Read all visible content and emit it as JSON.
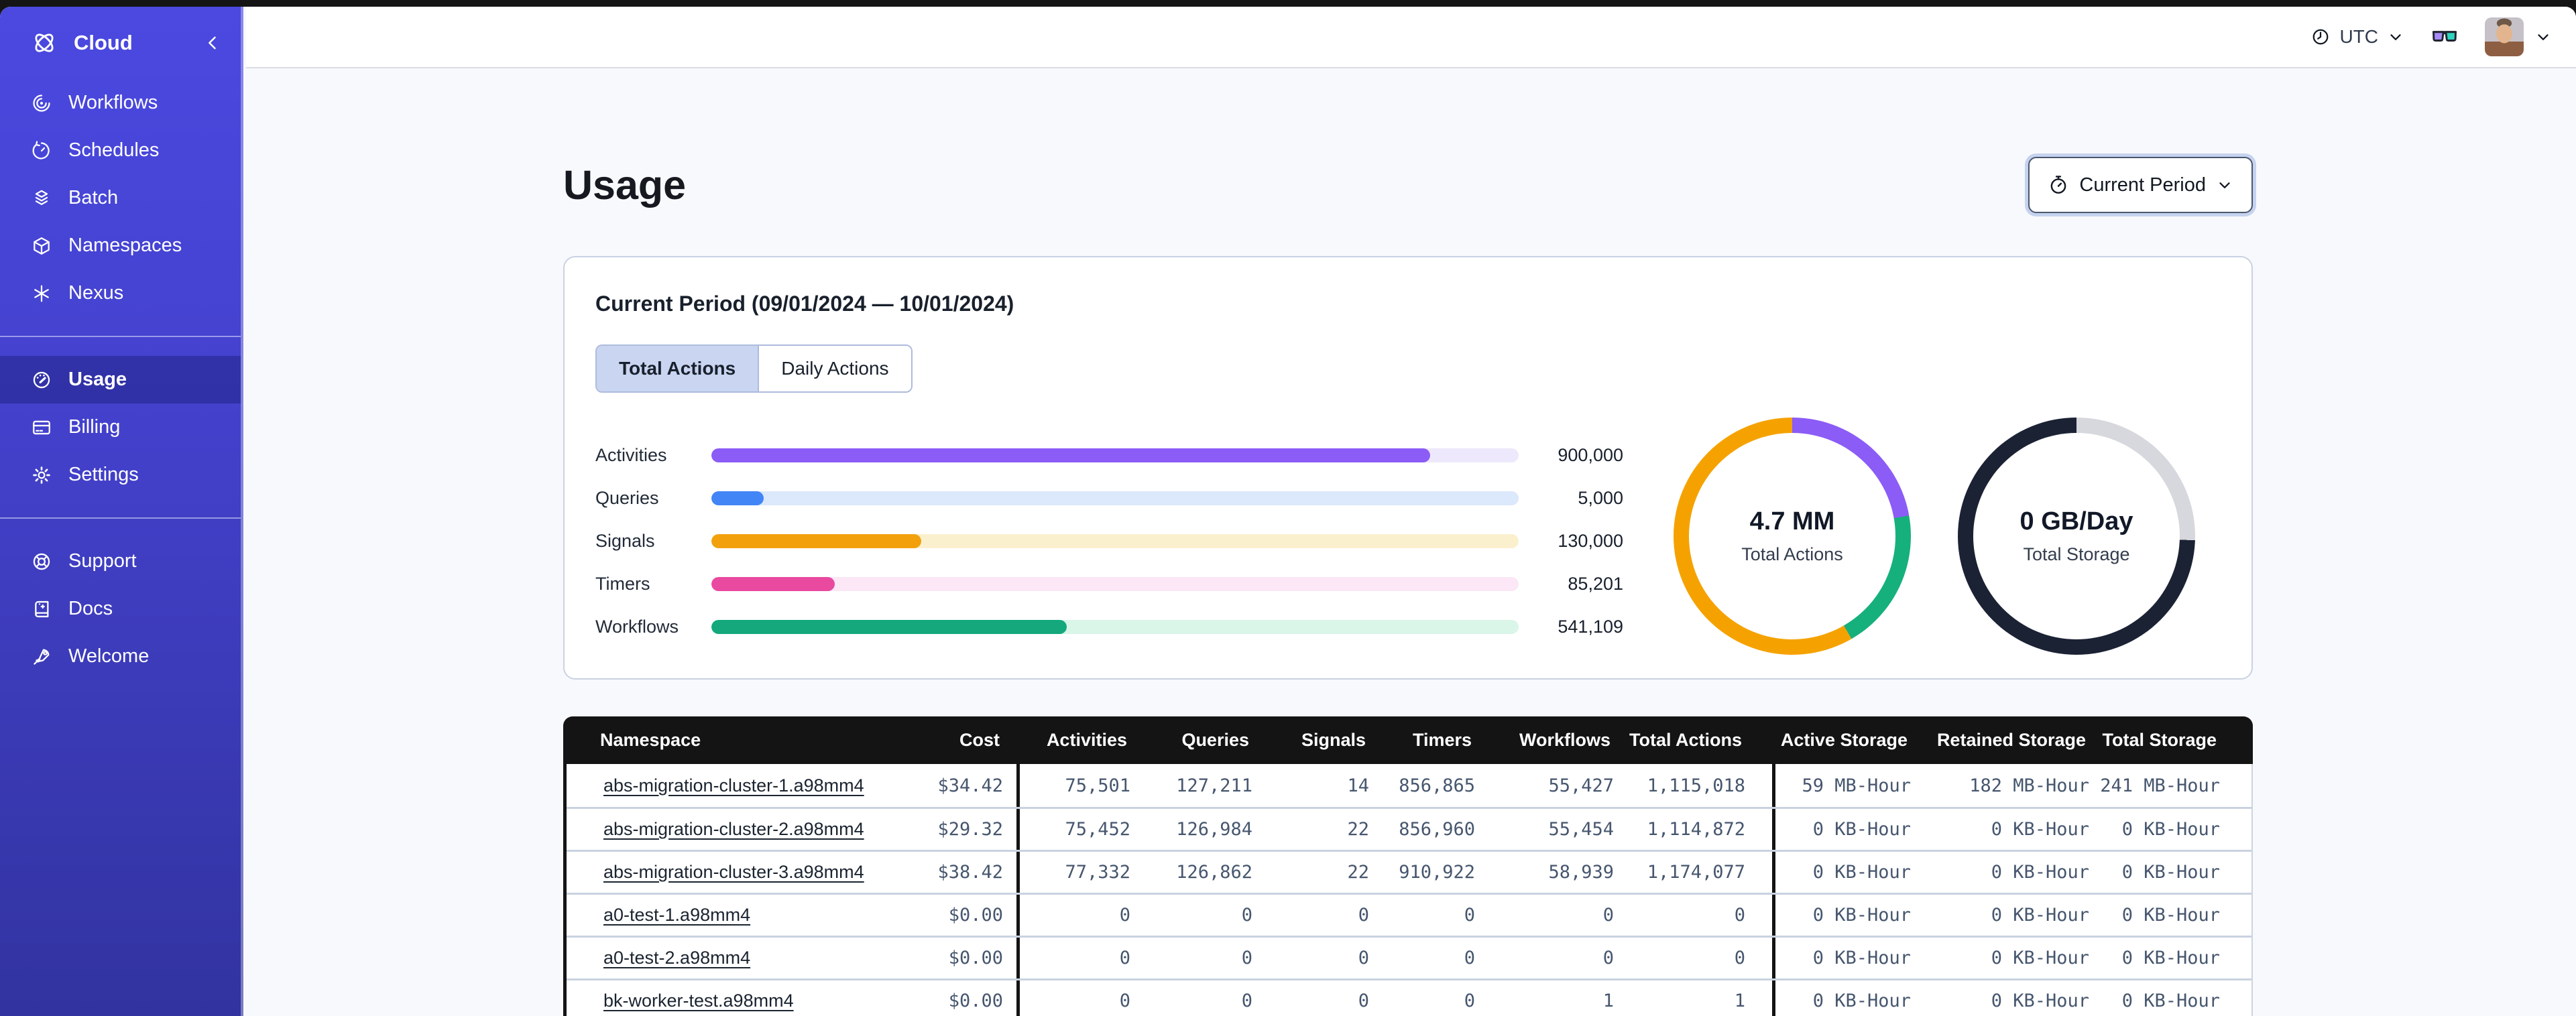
{
  "theme": {
    "sidebar_top": "#4B49E0",
    "sidebar_bottom": "#3233A0",
    "sidebar_selected": "rgba(13,16,96,0.35)",
    "topbar_bg": "#FFFFFF",
    "page_bg": "#F8F9FC",
    "header_bg": "#141414",
    "tab_selected_bg": "#C9D5F1",
    "focus_ring": "#C5D3EF",
    "card_border": "#C9D2E2",
    "cell": "#46566E",
    "glasses_left_lens": "#A78BFA",
    "glasses_right_lens": "#2DD4BF"
  },
  "sidebar": {
    "logo_label": "Cloud",
    "nav_main": [
      {
        "key": "workflows",
        "label": "Workflows",
        "icon": "workflows-icon"
      },
      {
        "key": "schedules",
        "label": "Schedules",
        "icon": "schedules-icon"
      },
      {
        "key": "batch",
        "label": "Batch",
        "icon": "batch-icon"
      },
      {
        "key": "namespaces",
        "label": "Namespaces",
        "icon": "namespaces-icon"
      },
      {
        "key": "nexus",
        "label": "Nexus",
        "icon": "nexus-icon"
      }
    ],
    "nav_account": [
      {
        "key": "usage",
        "label": "Usage",
        "icon": "usage-icon",
        "selected": true
      },
      {
        "key": "billing",
        "label": "Billing",
        "icon": "billing-icon"
      },
      {
        "key": "settings",
        "label": "Settings",
        "icon": "settings-icon"
      }
    ],
    "nav_footer": [
      {
        "key": "support",
        "label": "Support",
        "icon": "support-icon"
      },
      {
        "key": "docs",
        "label": "Docs",
        "icon": "docs-icon"
      },
      {
        "key": "welcome",
        "label": "Welcome",
        "icon": "welcome-icon"
      }
    ]
  },
  "topbar": {
    "timezone": "UTC"
  },
  "page": {
    "title": "Usage",
    "period_button_label": "Current Period"
  },
  "usage_card": {
    "title": "Current Period (09/01/2024 — 10/01/2024)",
    "tabs": [
      {
        "label": "Total Actions",
        "selected": true
      },
      {
        "label": "Daily Actions",
        "selected": false
      }
    ]
  },
  "chart_data": [
    {
      "type": "bar",
      "orientation": "horizontal",
      "title": "Total Actions by type",
      "categories": [
        "Activities",
        "Queries",
        "Signals",
        "Timers",
        "Workflows"
      ],
      "values": [
        900000,
        5000,
        130000,
        85201,
        541109
      ],
      "rows": [
        {
          "label": "Activities",
          "value": 900000,
          "value_display": "900,000",
          "fill_pct": 89,
          "color": "#8B5CF6",
          "track_color": "#EDE8FB"
        },
        {
          "label": "Queries",
          "value": 5000,
          "value_display": "5,000",
          "fill_pct": 6.5,
          "color": "#4285F6",
          "track_color": "#DCE8FB"
        },
        {
          "label": "Signals",
          "value": 130000,
          "value_display": "130,000",
          "fill_pct": 26,
          "color": "#F2A10D",
          "track_color": "#FBF0CE"
        },
        {
          "label": "Timers",
          "value": 85201,
          "value_display": "85,201",
          "fill_pct": 15.3,
          "color": "#E9499F",
          "track_color": "#FBE7F6"
        },
        {
          "label": "Workflows",
          "value": 541109,
          "value_display": "541,109",
          "fill_pct": 44,
          "color": "#14A87C",
          "track_color": "#D9F6E8"
        }
      ]
    },
    {
      "type": "donut",
      "label": "4.7 MM",
      "sublabel": "Total Actions",
      "segments": [
        {
          "color": "#8B5CF6",
          "start_deg": 0,
          "end_deg": 80,
          "approx_pct": 22
        },
        {
          "color": "#16B07C",
          "start_deg": 80,
          "end_deg": 150,
          "approx_pct": 19.5
        },
        {
          "color": "#F5A201",
          "start_deg": 150,
          "end_deg": 360,
          "approx_pct": 58.5
        }
      ]
    },
    {
      "type": "donut",
      "label": "0 GB/Day",
      "sublabel": "Total Storage",
      "segments": [
        {
          "color": "#D7D8DD",
          "start_deg": 0,
          "end_deg": 92,
          "approx_pct": 25.5
        },
        {
          "color": "#1B2234",
          "start_deg": 92,
          "end_deg": 360,
          "approx_pct": 74.5
        }
      ]
    }
  ],
  "table": {
    "columns": [
      "Namespace",
      "Cost",
      "Activities",
      "Queries",
      "Signals",
      "Timers",
      "Workflows",
      "Total Actions",
      "Active Storage",
      "Retained Storage",
      "Total Storage"
    ],
    "rows": [
      {
        "namespace": "abs-migration-cluster-1.a98mm4",
        "cost": "$34.42",
        "activities": "75,501",
        "queries": "127,211",
        "signals": "14",
        "timers": "856,865",
        "workflows": "55,427",
        "total_actions": "1,115,018",
        "active_storage": "59 MB-Hour",
        "retained_storage": "182 MB-Hour",
        "total_storage": "241 MB-Hour"
      },
      {
        "namespace": "abs-migration-cluster-2.a98mm4",
        "cost": "$29.32",
        "activities": "75,452",
        "queries": "126,984",
        "signals": "22",
        "timers": "856,960",
        "workflows": "55,454",
        "total_actions": "1,114,872",
        "active_storage": "0 KB-Hour",
        "retained_storage": "0 KB-Hour",
        "total_storage": "0 KB-Hour"
      },
      {
        "namespace": "abs-migration-cluster-3.a98mm4",
        "cost": "$38.42",
        "activities": "77,332",
        "queries": "126,862",
        "signals": "22",
        "timers": "910,922",
        "workflows": "58,939",
        "total_actions": "1,174,077",
        "active_storage": "0 KB-Hour",
        "retained_storage": "0 KB-Hour",
        "total_storage": "0 KB-Hour"
      },
      {
        "namespace": "a0-test-1.a98mm4",
        "cost": "$0.00",
        "activities": "0",
        "queries": "0",
        "signals": "0",
        "timers": "0",
        "workflows": "0",
        "total_actions": "0",
        "active_storage": "0 KB-Hour",
        "retained_storage": "0 KB-Hour",
        "total_storage": "0 KB-Hour"
      },
      {
        "namespace": "a0-test-2.a98mm4",
        "cost": "$0.00",
        "activities": "0",
        "queries": "0",
        "signals": "0",
        "timers": "0",
        "workflows": "0",
        "total_actions": "0",
        "active_storage": "0 KB-Hour",
        "retained_storage": "0 KB-Hour",
        "total_storage": "0 KB-Hour"
      },
      {
        "namespace": "bk-worker-test.a98mm4",
        "cost": "$0.00",
        "activities": "0",
        "queries": "0",
        "signals": "0",
        "timers": "0",
        "workflows": "1",
        "total_actions": "1",
        "active_storage": "0 KB-Hour",
        "retained_storage": "0 KB-Hour",
        "total_storage": "0 KB-Hour"
      }
    ]
  }
}
